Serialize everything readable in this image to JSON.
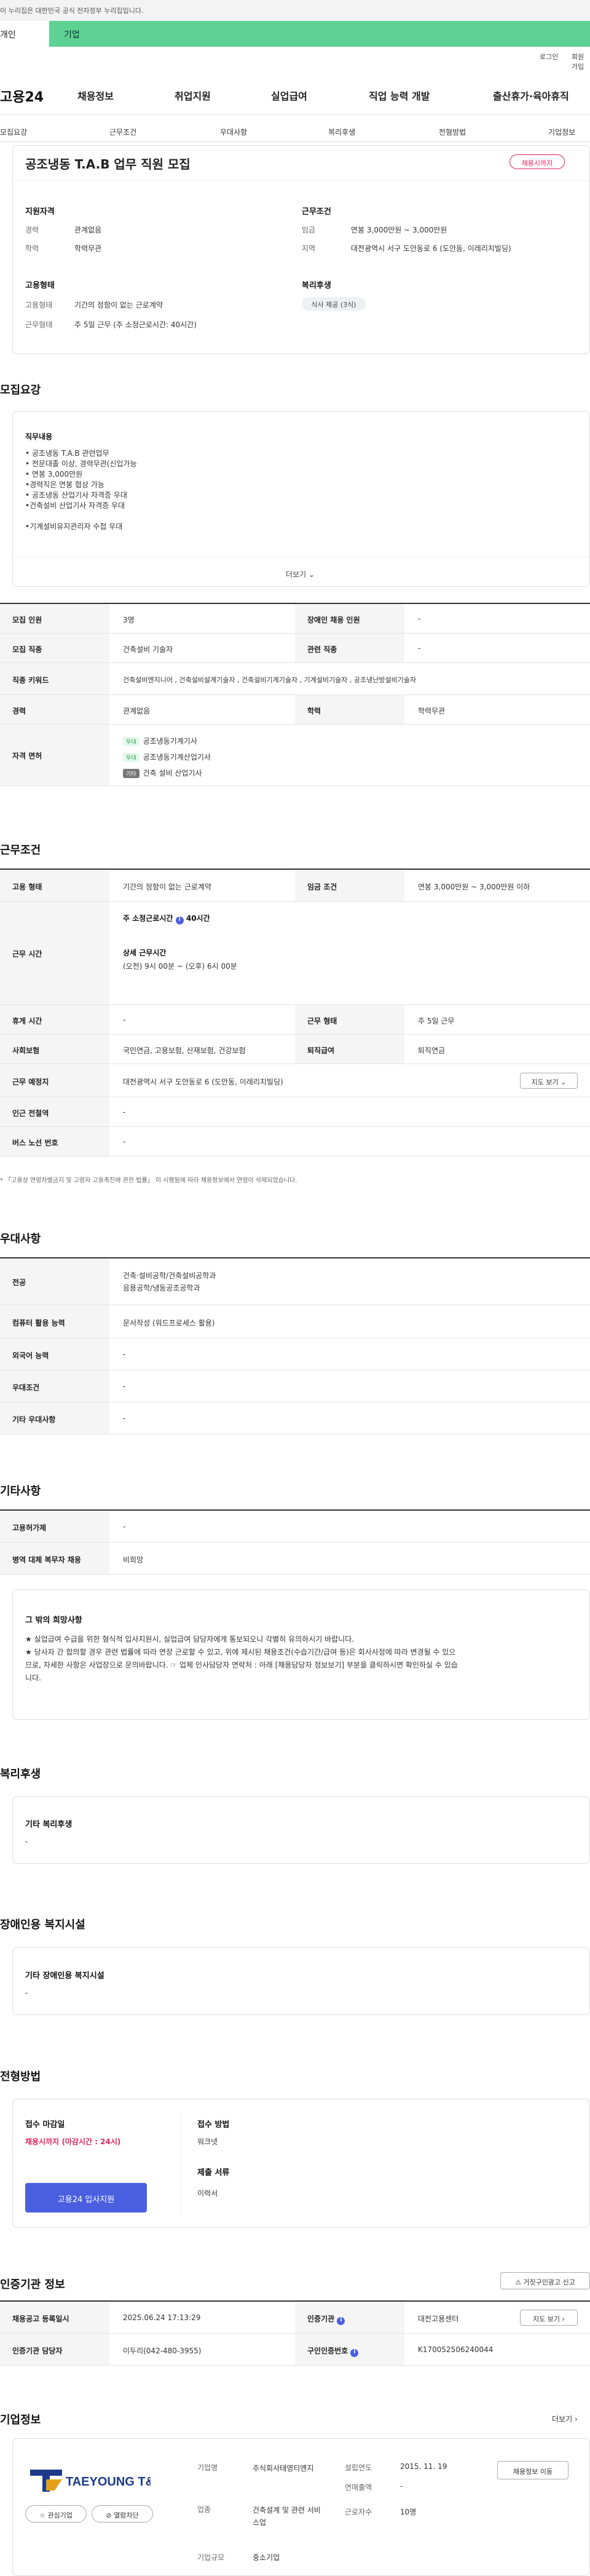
{
  "gov_banner": "이 누리집은 대한민국 공식 전자정부 누리집입니다.",
  "top_tabs": [
    "개인",
    "기업"
  ],
  "util_links": [
    "로그인",
    "회원가입"
  ],
  "site_logo": "고용24",
  "gnb": [
    "채용정보",
    "취업지원",
    "실업급여",
    "직업 능력 개발",
    "출산휴가·육아휴직"
  ],
  "subnav": [
    "모집요강",
    "근무조건",
    "우대사항",
    "복리후생",
    "전형방법",
    "기업정보"
  ],
  "job_title": "공조냉동 T.A.B 업무 직원 모집",
  "deadline_badge": "채용시까지",
  "summary": {
    "qual_title": "지원자격",
    "cond_title": "근무조건",
    "emp_title": "고용형태",
    "welfare_title": "복리후생",
    "career_label": "경력",
    "career": "관계없음",
    "edu_label": "학력",
    "edu": "학력무관",
    "wage_label": "임금",
    "wage": "연봉 3,000만원 ~ 3,000만원",
    "area_label": "지역",
    "area": "대전광역시 서구 도안동로 6 (도안동, 이레리치빌딩)",
    "type_label": "고용형태",
    "type": "기간의 정함이 없는 근로계약",
    "worktype_label": "근무형태",
    "worktype": "주 5일 근무 (주 소정근로시간: 40시간)",
    "welfare_tag": "식사 제공 (3식)"
  },
  "recruit": {
    "section": "모집요강",
    "duty_title": "직무내용",
    "duty_lines": [
      "• 공조냉동 T.A.B 관련업무",
      "• 전문대졸 이상, 경력무관(신입가능",
      "• 연봉 3,000만원",
      "•경력직은 연봉 협상 가능",
      "• 공조냉동 산업기사 자격증 우대",
      "•건축설비 산업기사 자격증 우대",
      "",
      "•기계설비유지관리자 수첩 우대"
    ],
    "more": "더보기",
    "rows": [
      {
        "l": "모집 인원",
        "v": "3명",
        "l2": "장애인 채용 인원",
        "v2": "-"
      },
      {
        "l": "모집 직종",
        "v": "건축설비 기술자",
        "l2": "관련 직종",
        "v2": "-"
      },
      {
        "l": "직종 키워드",
        "v": "건축설비엔지니어 , 건축설비설계기술자 , 건축설비기계기술자 , 기계설비기술자 , 공조냉난방설비기술자"
      },
      {
        "l": "경력",
        "v": "관계없음",
        "l2": "학력",
        "v2": "학력무관"
      }
    ],
    "license_label": "자격 면허",
    "licenses": [
      {
        "tag": "우대",
        "name": "공조냉동기계기사"
      },
      {
        "tag": "우대",
        "name": "공조냉동기계산업기사"
      },
      {
        "tag": "기타",
        "name": "건축 설비 산업기사"
      }
    ]
  },
  "work": {
    "section": "근무조건",
    "rows": [
      {
        "l": "고용 형태",
        "v": "기간의 정함이 없는 근로계약",
        "l2": "임금 조건",
        "v2": "연봉 3,000만원 ~ 3,000만원 이하"
      },
      {
        "l": "휴게 시간",
        "v": "-",
        "l2": "근무 형태",
        "v2": "주 5일 근무"
      },
      {
        "l": "사회보험",
        "v": "국민연금, 고용보험, 산재보험, 건강보험",
        "l2": "퇴직급여",
        "v2": "퇴직연금"
      },
      {
        "l": "근무 예정지",
        "v": "대전광역시 서구 도안동로 6 (도안동, 이레리치빌딩)"
      },
      {
        "l": "인근 전철역",
        "v": "-"
      },
      {
        "l": "버스 노선 번호",
        "v": "-"
      }
    ],
    "time_label": "근무 시간",
    "weekly": "주 소정근로시간",
    "weekly_val": "40시간",
    "detail_title": "상세 근무시간",
    "detail": "(오전) 9시 00분 ~ (오후) 6시 00분",
    "map_btn": "지도 보기",
    "note": "* 「고용상 연령차별금지 및 고령자 고용촉진에 관한 법률」 이 시행됨에 따라 채용정보에서 연령이 삭제되었습니다."
  },
  "pref": {
    "section": "우대사항",
    "rows": [
      {
        "l": "전공",
        "v": "건축·설비공학/건축설비공학과\n응용공학/냉동공조공학과"
      },
      {
        "l": "컴퓨터 활용 능력",
        "v": "문서작성 (워드프로세스 활용)"
      },
      {
        "l": "외국어 능력",
        "v": "-"
      },
      {
        "l": "우대조건",
        "v": "-"
      },
      {
        "l": "기타 우대사항",
        "v": "-"
      }
    ]
  },
  "etc": {
    "section": "기타사항",
    "rows": [
      {
        "l": "고용허가제",
        "v": "-"
      },
      {
        "l": "병역 대체 복무자 채용",
        "v": "비희망"
      }
    ],
    "box_title": "그 밖의 희망사항",
    "box_lines": [
      "★ 실업급여 수급을 위한 형식적 입사지원시, 실업급여 담당자에게 통보되오니 각별히 유의하시기 바랍니다.",
      "★ 당사자 간 합의할 경우 관련 법률에 따라 연장 근로할 수 있고, 위에 제시된 채용조건(수습기간/급여 등)은 회사사정에 따라 변경될 수 있으",
      "므로, 자세한 사항은 사업장으로 문의바랍니다.  ☞ 업체 인사담당자 연락처 : 아래 [채용담당자 정보보기] 부분을 클릭하시면 확인하실 수 있습",
      "니다."
    ]
  },
  "benefit": {
    "section": "복리후생",
    "title": "기타 복리후생",
    "value": "-"
  },
  "disability": {
    "section": "장애인용 복지시설",
    "title": "기타 장애인용 복지시설",
    "value": "-"
  },
  "process": {
    "section": "전형방법",
    "deadline_title": "접수 마감일",
    "deadline": "채용시까지 (마감시간 : 24시)",
    "method_title": "접수 방법",
    "method": "워크넷",
    "docs_title": "제출 서류",
    "docs": "이력서",
    "apply_btn": "고용24 입사지원"
  },
  "agency": {
    "section": "인증기관 정보",
    "report_btn": "거짓구인광고 신고",
    "reg_label": "채용공고 등록일시",
    "reg": "2025.06.24 17:13:29",
    "inst_label": "인증기관",
    "inst": "대전고용센터",
    "mgr_label": "인증기관 담당자",
    "mgr": "이두리(042-480-3955)",
    "no_label": "구인인증번호",
    "no": "K170052506240044",
    "map_btn": "지도 보기"
  },
  "company": {
    "section": "기업정보",
    "more": "더보기",
    "logo_text": "TAEYOUNG T&G",
    "interest_btn": "관심기업",
    "block_btn": "열람차단",
    "name_label": "기업명",
    "name": "주식회사태영티앤지",
    "found_label": "설립연도",
    "found": "2015. 11. 19",
    "sales_label": "연매출액",
    "sales": "-",
    "ind_label": "업종",
    "ind": "건축설계 및 관련 서비스업",
    "emp_label": "근로자수",
    "emp": "10명",
    "size_label": "기업규모",
    "size": "중소기업",
    "jobs_btn": "채용정보 이동"
  },
  "colors": {
    "green": "#5dd292",
    "blue": "#4a5fe0",
    "red": "#e0245e"
  }
}
